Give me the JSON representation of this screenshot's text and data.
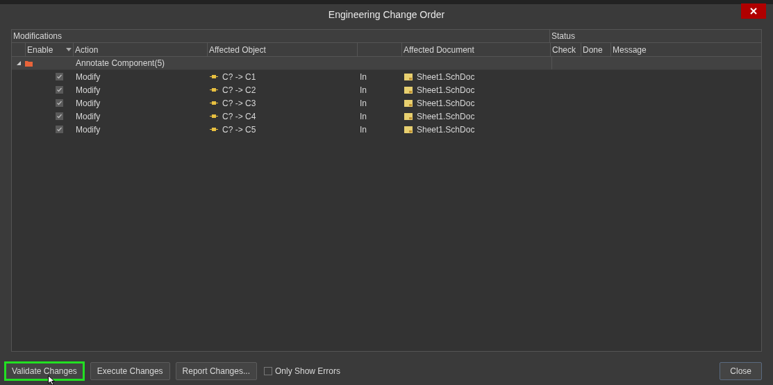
{
  "window": {
    "title": "Engineering Change Order"
  },
  "groups": [
    {
      "label": "Modifications"
    },
    {
      "label": "Status"
    }
  ],
  "columns": [
    {
      "label": "Enable",
      "sort": true
    },
    {
      "label": "Action",
      "sort": false
    },
    {
      "label": "Affected Object",
      "sort": false
    },
    {
      "label": "Affected Document",
      "sort": false
    },
    {
      "label": "Check",
      "sort": false
    },
    {
      "label": "Done",
      "sort": false
    },
    {
      "label": "Message",
      "sort": false
    }
  ],
  "tree": {
    "label": "Annotate Component(5)",
    "expanded": true,
    "children": [
      {
        "enabled": true,
        "action": "Modify",
        "object": "C? -> C1",
        "direction": "In",
        "document": "Sheet1.SchDoc"
      },
      {
        "enabled": true,
        "action": "Modify",
        "object": "C? -> C2",
        "direction": "In",
        "document": "Sheet1.SchDoc"
      },
      {
        "enabled": true,
        "action": "Modify",
        "object": "C? -> C3",
        "direction": "In",
        "document": "Sheet1.SchDoc"
      },
      {
        "enabled": true,
        "action": "Modify",
        "object": "C? -> C4",
        "direction": "In",
        "document": "Sheet1.SchDoc"
      },
      {
        "enabled": true,
        "action": "Modify",
        "object": "C? -> C5",
        "direction": "In",
        "document": "Sheet1.SchDoc"
      }
    ]
  },
  "buttons": [
    {
      "label": "Validate Changes",
      "highlighted": true
    },
    {
      "label": "Execute Changes",
      "highlighted": false
    },
    {
      "label": "Report Changes...",
      "highlighted": false
    }
  ],
  "only_show_errors": {
    "label": "Only Show Errors",
    "checked": false
  },
  "close_button": {
    "label": "Close"
  }
}
